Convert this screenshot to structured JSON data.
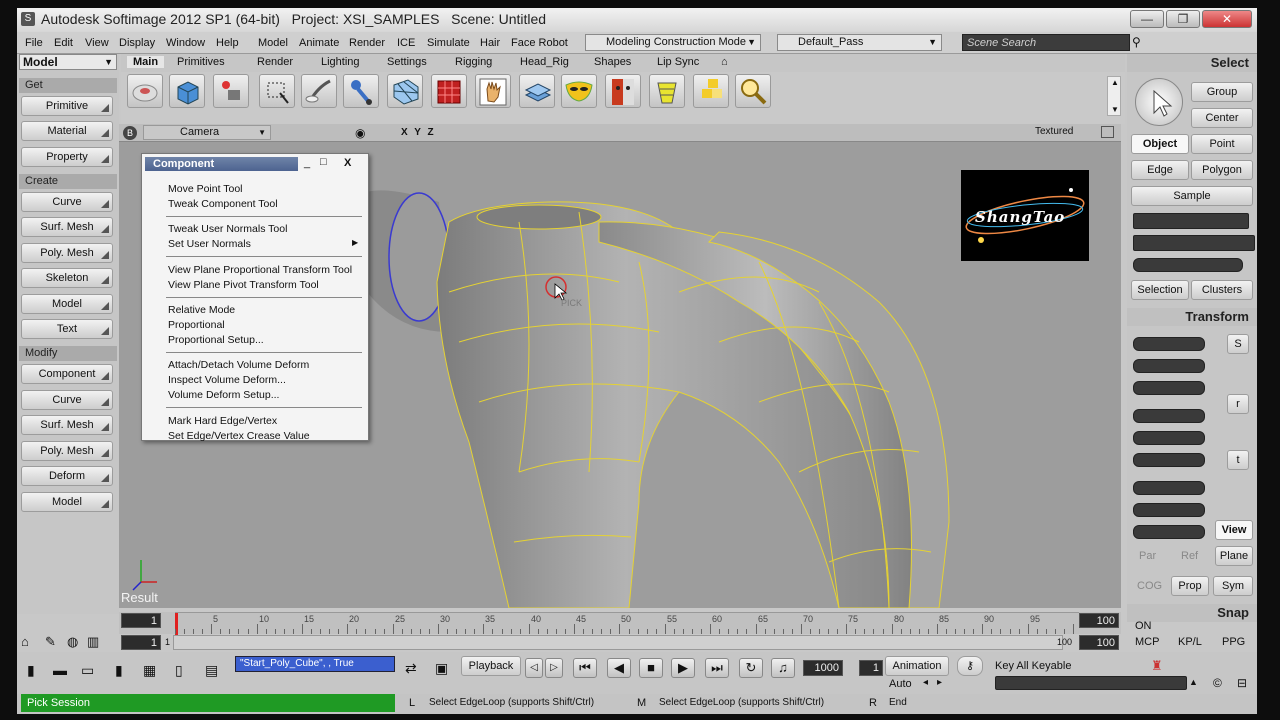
{
  "window": {
    "title": "Autodesk Softimage 2012 SP1 (64-bit)",
    "project": "Project: XSI_SAMPLES",
    "scene": "Scene: Untitled",
    "min": "—",
    "max": "❐",
    "close": "✕"
  },
  "menus": [
    "File",
    "Edit",
    "View",
    "Display",
    "Window",
    "Help",
    "Model",
    "Animate",
    "Render",
    "ICE",
    "Simulate",
    "Hair",
    "Face Robot"
  ],
  "mode_select": "Modeling Construction Mode",
  "pass_select": "Default_Pass",
  "scene_search": "Scene Search",
  "left": {
    "mode": "Model",
    "get": "Get",
    "create": "Create",
    "modify": "Modify",
    "get_items": [
      "Primitive",
      "Material",
      "Property"
    ],
    "create_items": [
      "Curve",
      "Surf. Mesh",
      "Poly. Mesh",
      "Skeleton",
      "Model",
      "Text"
    ],
    "modify_items": [
      "Component",
      "Curve",
      "Surf. Mesh",
      "Poly. Mesh",
      "Deform",
      "Model"
    ]
  },
  "tabs": [
    "Main",
    "Primitives",
    "Render",
    "Lighting",
    "Settings",
    "Rigging",
    "Head_Rig",
    "Shapes",
    "Lip Sync"
  ],
  "viewport": {
    "b": "B",
    "camera": "Camera",
    "xyz": "X Y Z",
    "textured": "Textured",
    "result": "Result",
    "pick": "PICK",
    "logo": "ShangTao"
  },
  "component_menu": {
    "title": "Component",
    "min": "_",
    "max": "□",
    "close": "X",
    "groups": [
      [
        "Move Point Tool",
        "Tweak Component Tool"
      ],
      [
        "Tweak User Normals Tool",
        "Set User Normals"
      ],
      [
        "View Plane Proportional Transform Tool",
        "View Plane Pivot Transform Tool"
      ],
      [
        "Relative Mode",
        "Proportional",
        "Proportional Setup..."
      ],
      [
        "Attach/Detach Volume Deform",
        "Inspect Volume Deform...",
        "Volume Deform Setup..."
      ],
      [
        "Mark Hard Edge/Vertex",
        "Set Edge/Vertex Crease Value"
      ]
    ]
  },
  "right": {
    "select": "Select",
    "group": "Group",
    "center": "Center",
    "object": "Object",
    "point": "Point",
    "edge": "Edge",
    "polygon": "Polygon",
    "sample": "Sample",
    "selection": "Selection",
    "clusters": "Clusters",
    "transform": "Transform",
    "s": "S",
    "r": "r",
    "t": "t",
    "view": "View",
    "par": "Par",
    "ref": "Ref",
    "plane": "Plane",
    "cog": "COG",
    "prop": "Prop",
    "sym": "Sym",
    "snap": "Snap",
    "on": "ON",
    "mcp": "MCP",
    "kpl": "KP/L",
    "ppg": "PPG"
  },
  "timeline": {
    "start": "1",
    "end": "100",
    "labels": [
      "5",
      "10",
      "15",
      "20",
      "25",
      "30",
      "35",
      "40",
      "45",
      "50",
      "55",
      "60",
      "65",
      "70",
      "75",
      "80",
      "85",
      "90",
      "95"
    ],
    "field_start": "1",
    "field_cur": "1",
    "field_end1": "100",
    "field_end2": "100",
    "end_small": "100"
  },
  "playback": {
    "script": "\"Start_Poly_Cube\", , True",
    "playback": "Playback",
    "frame": "1000",
    "current": "1",
    "animation": "Animation",
    "auto": "Auto",
    "keyable": "Key All Keyable"
  },
  "status": {
    "session": "Pick Session",
    "l": "L",
    "l_hint": "Select EdgeLoop (supports Shift/Ctrl)",
    "m": "M",
    "m_hint": "Select EdgeLoop (supports Shift/Ctrl)",
    "r": "R",
    "r_hint": "End"
  },
  "colors": {
    "accent": "#f0dc3c",
    "status_green": "#1f9a24",
    "menu_header": "#5a6f99",
    "mesh": "#a5a5a5"
  }
}
